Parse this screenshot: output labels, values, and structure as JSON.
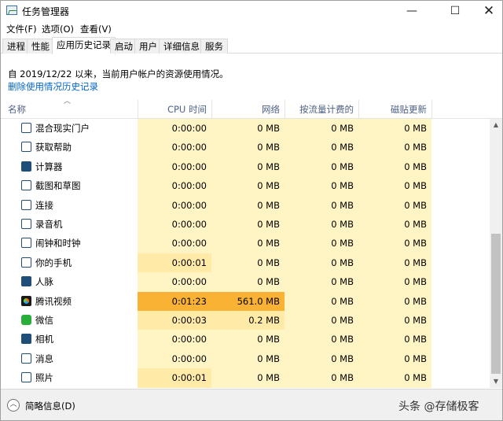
{
  "window": {
    "title": "任务管理器",
    "minimize": "—",
    "maximize": "☐",
    "close": "✕"
  },
  "menu": [
    "文件(F)",
    "选项(O)",
    "查看(V)"
  ],
  "tabs": [
    "进程",
    "性能",
    "应用历史记录",
    "启动",
    "用户",
    "详细信息",
    "服务"
  ],
  "active_tab": "应用历史记录",
  "info": {
    "since": "自 2019/12/22 以来，当前用户帐户的资源使用情况。",
    "delete_link": "删除使用情况历史记录"
  },
  "columns": {
    "name": "名称",
    "cpu": "CPU 时间",
    "network": "网络",
    "metered": "按流量计费的网...",
    "tile": "磁贴更新"
  },
  "rows": [
    {
      "icon": "mixed-reality-icon",
      "name": "混合现实门户",
      "cpu": "0:00:00",
      "network": "0 MB",
      "metered": "0 MB",
      "tile": "0 MB"
    },
    {
      "icon": "get-help-icon",
      "name": "获取帮助",
      "cpu": "0:00:00",
      "network": "0 MB",
      "metered": "0 MB",
      "tile": "0 MB"
    },
    {
      "icon": "calculator-icon",
      "name": "计算器",
      "cpu": "0:00:00",
      "network": "0 MB",
      "metered": "0 MB",
      "tile": "0 MB"
    },
    {
      "icon": "snip-sketch-icon",
      "name": "截图和草图",
      "cpu": "0:00:00",
      "network": "0 MB",
      "metered": "0 MB",
      "tile": "0 MB"
    },
    {
      "icon": "connect-icon",
      "name": "连接",
      "cpu": "0:00:00",
      "network": "0 MB",
      "metered": "0 MB",
      "tile": "0 MB"
    },
    {
      "icon": "voice-recorder-icon",
      "name": "录音机",
      "cpu": "0:00:00",
      "network": "0 MB",
      "metered": "0 MB",
      "tile": "0 MB"
    },
    {
      "icon": "alarm-clock-icon",
      "name": "闹钟和时钟",
      "cpu": "0:00:00",
      "network": "0 MB",
      "metered": "0 MB",
      "tile": "0 MB"
    },
    {
      "icon": "your-phone-icon",
      "name": "你的手机",
      "cpu": "0:00:01",
      "network": "0 MB",
      "metered": "0 MB",
      "tile": "0 MB"
    },
    {
      "icon": "people-icon",
      "name": "人脉",
      "cpu": "0:00:00",
      "network": "0 MB",
      "metered": "0 MB",
      "tile": "0 MB"
    },
    {
      "icon": "tencent-video-icon",
      "name": "腾讯视频",
      "cpu": "0:01:23",
      "network": "561.0 MB",
      "metered": "0 MB",
      "tile": "0 MB"
    },
    {
      "icon": "wechat-icon",
      "name": "微信",
      "cpu": "0:00:03",
      "network": "0.2 MB",
      "metered": "0 MB",
      "tile": "0 MB"
    },
    {
      "icon": "camera-icon",
      "name": "相机",
      "cpu": "0:00:00",
      "network": "0 MB",
      "metered": "0 MB",
      "tile": "0 MB"
    },
    {
      "icon": "messaging-icon",
      "name": "消息",
      "cpu": "0:00:00",
      "network": "0 MB",
      "metered": "0 MB",
      "tile": "0 MB"
    },
    {
      "icon": "photos-icon",
      "name": "照片",
      "cpu": "0:00:01",
      "network": "0 MB",
      "metered": "0 MB",
      "tile": "0 MB"
    }
  ],
  "footer": {
    "fewer_details": "简略信息(D)",
    "watermark": "头条 @存储极客"
  },
  "colors": {
    "heat_low": "#fff4c4",
    "heat_mid": "#ffeaa8",
    "heat_high": "#f9b234",
    "heat_peak": "#ffd27a",
    "link": "#0066cc",
    "header_text": "#4d6082"
  }
}
